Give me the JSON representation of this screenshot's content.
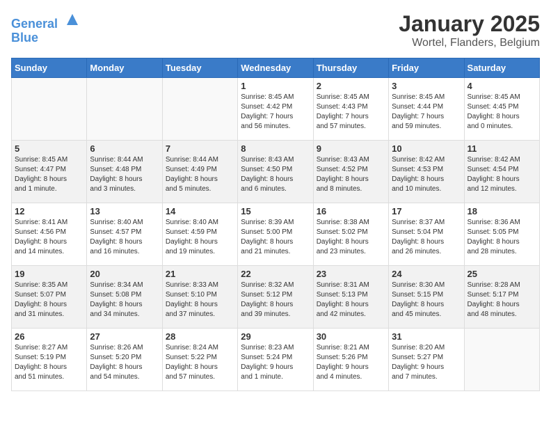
{
  "header": {
    "logo_line1": "General",
    "logo_line2": "Blue",
    "title": "January 2025",
    "subtitle": "Wortel, Flanders, Belgium"
  },
  "weekdays": [
    "Sunday",
    "Monday",
    "Tuesday",
    "Wednesday",
    "Thursday",
    "Friday",
    "Saturday"
  ],
  "weeks": [
    [
      {
        "day": "",
        "info": ""
      },
      {
        "day": "",
        "info": ""
      },
      {
        "day": "",
        "info": ""
      },
      {
        "day": "1",
        "info": "Sunrise: 8:45 AM\nSunset: 4:42 PM\nDaylight: 7 hours\nand 56 minutes."
      },
      {
        "day": "2",
        "info": "Sunrise: 8:45 AM\nSunset: 4:43 PM\nDaylight: 7 hours\nand 57 minutes."
      },
      {
        "day": "3",
        "info": "Sunrise: 8:45 AM\nSunset: 4:44 PM\nDaylight: 7 hours\nand 59 minutes."
      },
      {
        "day": "4",
        "info": "Sunrise: 8:45 AM\nSunset: 4:45 PM\nDaylight: 8 hours\nand 0 minutes."
      }
    ],
    [
      {
        "day": "5",
        "info": "Sunrise: 8:45 AM\nSunset: 4:47 PM\nDaylight: 8 hours\nand 1 minute."
      },
      {
        "day": "6",
        "info": "Sunrise: 8:44 AM\nSunset: 4:48 PM\nDaylight: 8 hours\nand 3 minutes."
      },
      {
        "day": "7",
        "info": "Sunrise: 8:44 AM\nSunset: 4:49 PM\nDaylight: 8 hours\nand 5 minutes."
      },
      {
        "day": "8",
        "info": "Sunrise: 8:43 AM\nSunset: 4:50 PM\nDaylight: 8 hours\nand 6 minutes."
      },
      {
        "day": "9",
        "info": "Sunrise: 8:43 AM\nSunset: 4:52 PM\nDaylight: 8 hours\nand 8 minutes."
      },
      {
        "day": "10",
        "info": "Sunrise: 8:42 AM\nSunset: 4:53 PM\nDaylight: 8 hours\nand 10 minutes."
      },
      {
        "day": "11",
        "info": "Sunrise: 8:42 AM\nSunset: 4:54 PM\nDaylight: 8 hours\nand 12 minutes."
      }
    ],
    [
      {
        "day": "12",
        "info": "Sunrise: 8:41 AM\nSunset: 4:56 PM\nDaylight: 8 hours\nand 14 minutes."
      },
      {
        "day": "13",
        "info": "Sunrise: 8:40 AM\nSunset: 4:57 PM\nDaylight: 8 hours\nand 16 minutes."
      },
      {
        "day": "14",
        "info": "Sunrise: 8:40 AM\nSunset: 4:59 PM\nDaylight: 8 hours\nand 19 minutes."
      },
      {
        "day": "15",
        "info": "Sunrise: 8:39 AM\nSunset: 5:00 PM\nDaylight: 8 hours\nand 21 minutes."
      },
      {
        "day": "16",
        "info": "Sunrise: 8:38 AM\nSunset: 5:02 PM\nDaylight: 8 hours\nand 23 minutes."
      },
      {
        "day": "17",
        "info": "Sunrise: 8:37 AM\nSunset: 5:04 PM\nDaylight: 8 hours\nand 26 minutes."
      },
      {
        "day": "18",
        "info": "Sunrise: 8:36 AM\nSunset: 5:05 PM\nDaylight: 8 hours\nand 28 minutes."
      }
    ],
    [
      {
        "day": "19",
        "info": "Sunrise: 8:35 AM\nSunset: 5:07 PM\nDaylight: 8 hours\nand 31 minutes."
      },
      {
        "day": "20",
        "info": "Sunrise: 8:34 AM\nSunset: 5:08 PM\nDaylight: 8 hours\nand 34 minutes."
      },
      {
        "day": "21",
        "info": "Sunrise: 8:33 AM\nSunset: 5:10 PM\nDaylight: 8 hours\nand 37 minutes."
      },
      {
        "day": "22",
        "info": "Sunrise: 8:32 AM\nSunset: 5:12 PM\nDaylight: 8 hours\nand 39 minutes."
      },
      {
        "day": "23",
        "info": "Sunrise: 8:31 AM\nSunset: 5:13 PM\nDaylight: 8 hours\nand 42 minutes."
      },
      {
        "day": "24",
        "info": "Sunrise: 8:30 AM\nSunset: 5:15 PM\nDaylight: 8 hours\nand 45 minutes."
      },
      {
        "day": "25",
        "info": "Sunrise: 8:28 AM\nSunset: 5:17 PM\nDaylight: 8 hours\nand 48 minutes."
      }
    ],
    [
      {
        "day": "26",
        "info": "Sunrise: 8:27 AM\nSunset: 5:19 PM\nDaylight: 8 hours\nand 51 minutes."
      },
      {
        "day": "27",
        "info": "Sunrise: 8:26 AM\nSunset: 5:20 PM\nDaylight: 8 hours\nand 54 minutes."
      },
      {
        "day": "28",
        "info": "Sunrise: 8:24 AM\nSunset: 5:22 PM\nDaylight: 8 hours\nand 57 minutes."
      },
      {
        "day": "29",
        "info": "Sunrise: 8:23 AM\nSunset: 5:24 PM\nDaylight: 9 hours\nand 1 minute."
      },
      {
        "day": "30",
        "info": "Sunrise: 8:21 AM\nSunset: 5:26 PM\nDaylight: 9 hours\nand 4 minutes."
      },
      {
        "day": "31",
        "info": "Sunrise: 8:20 AM\nSunset: 5:27 PM\nDaylight: 9 hours\nand 7 minutes."
      },
      {
        "day": "",
        "info": ""
      }
    ]
  ]
}
